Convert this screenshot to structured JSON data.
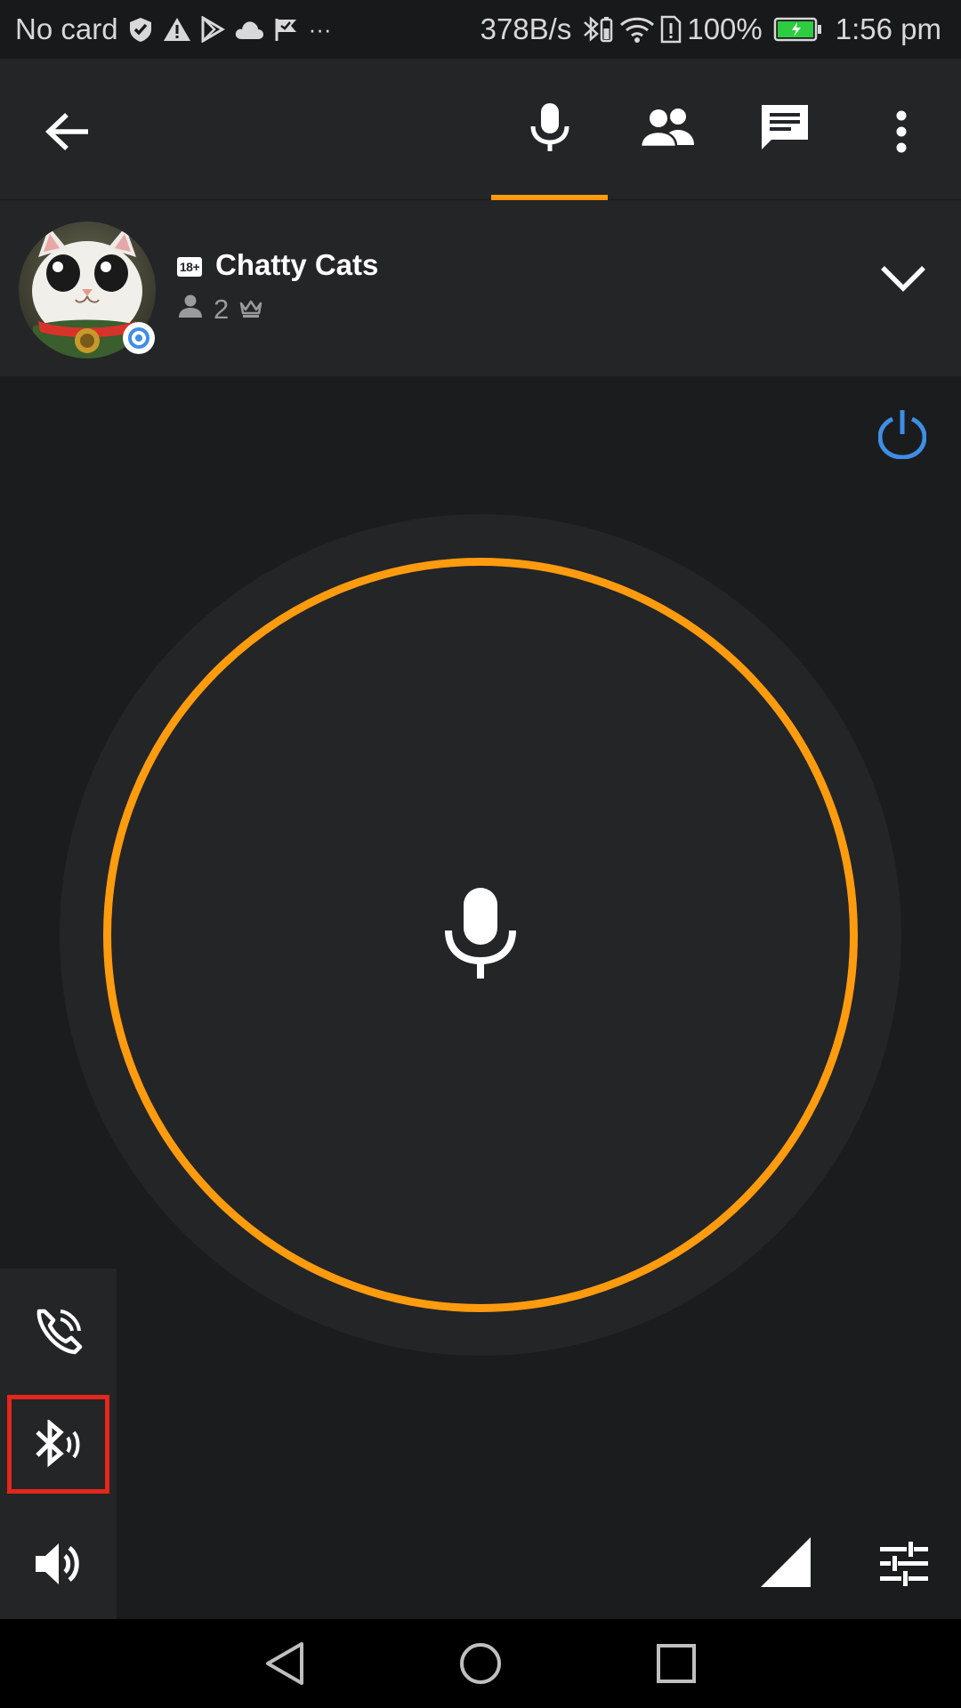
{
  "status_bar": {
    "carrier": "No card",
    "icons_left": [
      "check-shield-icon",
      "warning-icon",
      "play-store-icon",
      "cloud-icon",
      "check-flag-icon",
      "more-dots-icon"
    ],
    "more": "···",
    "net_speed": "378B/s",
    "battery": "100%",
    "time": "1:56 pm"
  },
  "app_bar": {
    "back_icon": "arrow-back-icon",
    "tabs": [
      {
        "icon": "microphone-icon",
        "active": true
      },
      {
        "icon": "people-icon",
        "active": false
      },
      {
        "icon": "chat-icon",
        "active": false
      }
    ],
    "overflow_icon": "more-vert-icon",
    "accent": "#ff9b0f"
  },
  "channel": {
    "age_badge": "18+",
    "name": "Chatty Cats",
    "member_count": "2",
    "status_color": "#3f8ee6"
  },
  "main": {
    "power_color": "#3f8ee6",
    "ptt_ring_color": "#ff9b0f"
  },
  "side_panel": {
    "items": [
      "phone-audio-icon",
      "bluetooth-audio-icon",
      "speaker-icon"
    ]
  },
  "nav_bar": {
    "items": [
      "back-triangle-icon",
      "home-circle-icon",
      "recents-square-icon"
    ]
  }
}
